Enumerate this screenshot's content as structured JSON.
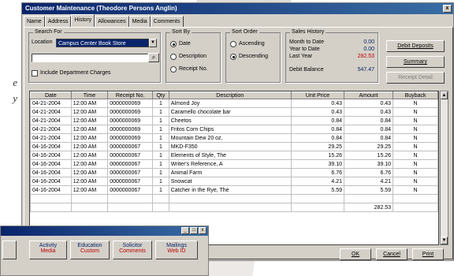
{
  "side_text": [
    "e",
    "y"
  ],
  "window": {
    "title": "Customer Maintenance  (Theodore Persons Anglin)",
    "close_glyph": "x"
  },
  "tabs": [
    "Name",
    "Address",
    "History",
    "Allowances",
    "Media",
    "Comments"
  ],
  "active_tab": 2,
  "search_for": {
    "legend": "Search For",
    "location_label": "Location",
    "location_value": "Campus Center Book Store",
    "include_label": "Include Department Charges"
  },
  "sort_by": {
    "legend": "Sort By",
    "options": [
      "Date",
      "Description",
      "Receipt No."
    ],
    "selected": 0
  },
  "sort_order": {
    "legend": "Sort Order",
    "options": [
      "Ascending",
      "Descending"
    ],
    "selected": 1
  },
  "sales_history": {
    "legend": "Sales History",
    "month_label": "Month to Date",
    "month_value": "0.00",
    "year_label": "Year to Date",
    "year_value": "0.00",
    "last_label": "Last Year",
    "last_value": "282.53",
    "debit_label": "Debit Balance",
    "debit_value": "547.47"
  },
  "buttons": {
    "debit_deposits": "Debit Deposits",
    "summary": "Summary",
    "receipt_detail": "Receipt Detail",
    "ok": "OK",
    "cancel": "Cancel",
    "print": "Print"
  },
  "grid": {
    "columns": [
      "Date",
      "Time",
      "Receipt No.",
      "Qty",
      "Description",
      "Unit Price",
      "Amount",
      "Buyback"
    ],
    "rows": [
      [
        "04-21-2004",
        "12:00 AM",
        "0000000069",
        "1",
        "Almond Joy",
        "0.43",
        "0.43",
        "N"
      ],
      [
        "04-21-2004",
        "12:00 AM",
        "0000000069",
        "1",
        "Caramello chocolate bar",
        "0.43",
        "0.43",
        "N"
      ],
      [
        "04-21-2004",
        "12:00 AM",
        "0000000069",
        "1",
        "Cheetos",
        "0.84",
        "0.84",
        "N"
      ],
      [
        "04-21-2004",
        "12:00 AM",
        "0000000069",
        "1",
        "Fritos Corn Chips",
        "0.84",
        "0.84",
        "N"
      ],
      [
        "04-21-2004",
        "12:00 AM",
        "0000000069",
        "1",
        "Mountain Dew 20 oz.",
        "0.84",
        "0.84",
        "N"
      ],
      [
        "04-16-2004",
        "12:00 AM",
        "0000000067",
        "1",
        "MKD-F350",
        "29.25",
        "29.25",
        "N"
      ],
      [
        "04-16-2004",
        "12:00 AM",
        "0000000067",
        "1",
        "Elements of Style, The",
        "15.26",
        "15.26",
        "N"
      ],
      [
        "04-16-2004",
        "12:00 AM",
        "0000000067",
        "1",
        "Writer's Reference, A",
        "39.10",
        "39.10",
        "N"
      ],
      [
        "04-16-2004",
        "12:00 AM",
        "0000000067",
        "1",
        "Animal Farm",
        "6.76",
        "6.76",
        "N"
      ],
      [
        "04-16-2004",
        "12:00 AM",
        "0000000067",
        "1",
        "Snowcat",
        "4.21",
        "4.21",
        "N"
      ],
      [
        "04-16-2004",
        "12:00 AM",
        "0000000067",
        "1",
        "Catcher in the Rye, The",
        "5.59",
        "5.59",
        "N"
      ],
      [
        "",
        "",
        "",
        "",
        "",
        "",
        "",
        ""
      ]
    ],
    "total_amount": "282.53"
  },
  "win2": {
    "controls": [
      "_",
      "□",
      "x"
    ],
    "tabs": [
      {
        "top": "",
        "bot": ""
      },
      {
        "top": "Activity",
        "bot": "Media"
      },
      {
        "top": "Education",
        "bot": "Custom"
      },
      {
        "top": "Solicitor",
        "bot": "Comments"
      },
      {
        "top": "Mailings",
        "bot": "Web ID"
      }
    ]
  }
}
